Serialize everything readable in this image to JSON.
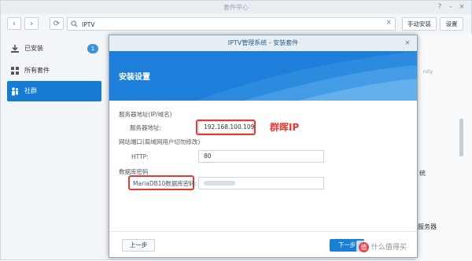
{
  "window": {
    "title": "套件中心"
  },
  "toolbar": {
    "search_value": "IPTV",
    "manual_install_label": "手动安装",
    "settings_label": "设置"
  },
  "sidebar": {
    "items": [
      {
        "label": "已安装",
        "badge": "1",
        "icon": "download-icon"
      },
      {
        "label": "所有套件",
        "icon": "grid-icon"
      },
      {
        "label": "社群",
        "icon": "community-icon"
      }
    ]
  },
  "right_pane": {
    "texts": [
      "nity",
      "统",
      "服务器"
    ]
  },
  "modal": {
    "title": "IPTV管理系统 - 安装套件",
    "banner_title": "安装设置",
    "server_section": "服务器地址(IP/域名)",
    "server_label": "服务器地址:",
    "server_value": "192.168.100.109",
    "server_annotation": "群晖IP",
    "port_section": "网站端口(局域网用户切勿修改)",
    "http_label": "HTTP:",
    "http_value": "80",
    "db_section": "数据库密码",
    "db_label": "MariaDB10数据库密码:",
    "back_label": "上一步",
    "next_label": "下一步"
  },
  "watermark": {
    "icon_text": "值",
    "text": "什么值得买"
  },
  "colors": {
    "accent": "#167bd2",
    "highlight": "#e53935"
  }
}
